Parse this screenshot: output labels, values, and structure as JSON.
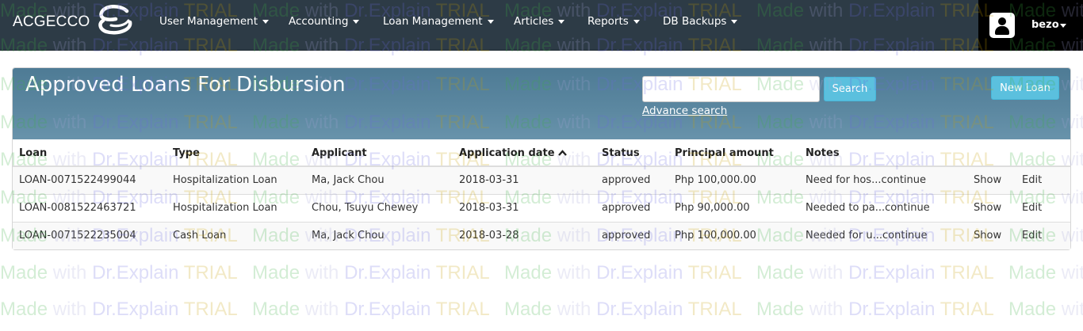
{
  "navbar": {
    "brand": "ACGECCO",
    "menu": [
      {
        "label": "User Management"
      },
      {
        "label": "Accounting"
      },
      {
        "label": "Loan Management"
      },
      {
        "label": "Articles"
      },
      {
        "label": "Reports"
      },
      {
        "label": "DB Backups"
      }
    ],
    "user": {
      "name": "bezo"
    }
  },
  "panel": {
    "title": "Approved Loans For Disbursion",
    "search": {
      "value": "",
      "placeholder": "",
      "button_label": "Search"
    },
    "advance_search_label": "Advance search",
    "new_loan_label": "New Loan"
  },
  "table": {
    "columns": [
      "Loan",
      "Type",
      "Applicant",
      "Application date",
      "Status",
      "Principal amount",
      "Notes"
    ],
    "sorted_column": "Application date",
    "sort_icon": "chevron-up-icon",
    "rows": [
      {
        "loan": "LOAN-0071522499044",
        "type": "Hospitalization Loan",
        "applicant": "Ma, Jack Chou",
        "date": "2018-03-31",
        "status": "approved",
        "amount": "Php 100,000.00",
        "notes": "Need for hos...",
        "continue": "continue",
        "show": "Show",
        "edit": "Edit"
      },
      {
        "loan": "LOAN-0081522463721",
        "type": "Hospitalization Loan",
        "applicant": "Chou, Tsuyu Chewey",
        "date": "2018-03-31",
        "status": "approved",
        "amount": "Php 90,000.00",
        "notes": "Needed to pa...",
        "continue": "continue",
        "show": "Show",
        "edit": "Edit"
      },
      {
        "loan": "LOAN-0071522235004",
        "type": "Cash Loan",
        "applicant": "Ma, Jack Chou",
        "date": "2018-03-28",
        "status": "approved",
        "amount": "Php 100,000.00",
        "notes": "Needed for u...",
        "continue": "continue",
        "show": "Show",
        "edit": "Edit"
      }
    ]
  },
  "watermark": {
    "made": "Made",
    "with": "with",
    "dr": "Dr.Explain",
    "trial": "TRIAL"
  },
  "colors": {
    "navbar": "#2d3b46",
    "panel_heading": "#5c88a1",
    "accent_button": "#5bc0de",
    "user_box": "#000000"
  }
}
